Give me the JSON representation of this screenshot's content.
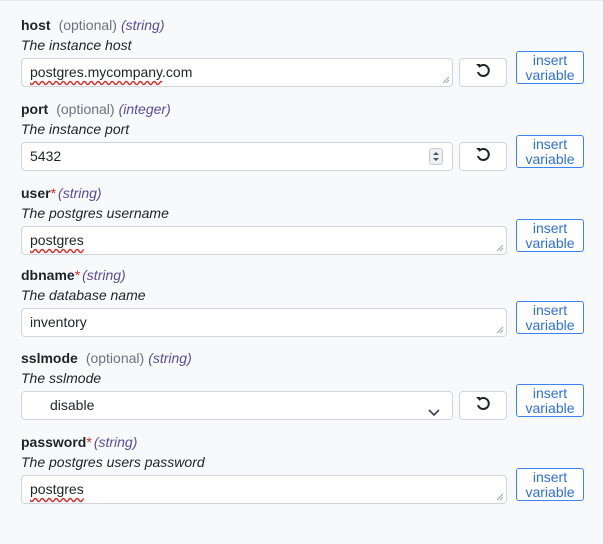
{
  "optional_label": "(optional)",
  "required_marker": "*",
  "insert_variable_label": "insert variable",
  "fields": [
    {
      "name": "host",
      "type": "(string)",
      "description": "The instance host",
      "value_spell": "postgres.mycompany",
      "value_rest": ".com"
    },
    {
      "name": "port",
      "type": "(integer)",
      "description": "The instance port",
      "value": "5432"
    },
    {
      "name": "user",
      "type": "(string)",
      "description": "The postgres username",
      "value": "postgres"
    },
    {
      "name": "dbname",
      "type": "(string)",
      "description": "The database name",
      "value": "inventory"
    },
    {
      "name": "sslmode",
      "type": "(string)",
      "description": "The sslmode",
      "value": "disable"
    },
    {
      "name": "password",
      "type": "(string)",
      "description": "The postgres users password",
      "value": "postgres"
    }
  ],
  "icons": {
    "reset": "undo-icon",
    "resize": "resize-grip-icon",
    "spinner": "number-spinner-icon",
    "dropdown": "chevron-down-icon"
  }
}
